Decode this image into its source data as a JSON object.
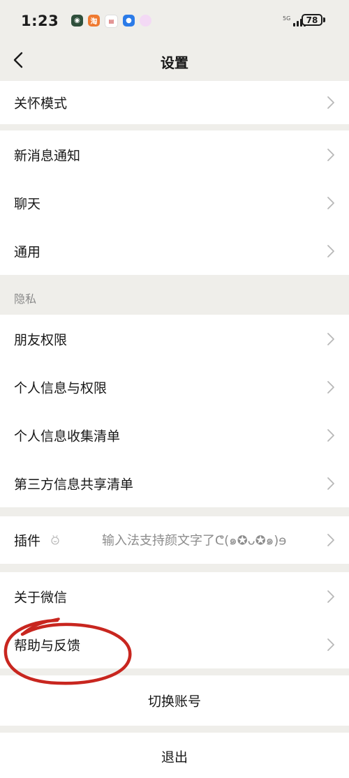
{
  "status_bar": {
    "time": "1:23",
    "battery": "78",
    "network_label": "5G"
  },
  "nav": {
    "title": "设置"
  },
  "section_top": {
    "items": [
      {
        "label": "关怀模式"
      }
    ]
  },
  "section_general": {
    "items": [
      {
        "label": "新消息通知"
      },
      {
        "label": "聊天"
      },
      {
        "label": "通用"
      }
    ]
  },
  "privacy": {
    "group_label": "隐私",
    "items": [
      {
        "label": "朋友权限"
      },
      {
        "label": "个人信息与权限"
      },
      {
        "label": "个人信息收集清单"
      },
      {
        "label": "第三方信息共享清单"
      }
    ]
  },
  "plugins": {
    "label": "插件",
    "value": "输入法支持颜文字了ᕦ(๑✪ᴗ✪๑)ɘ"
  },
  "about": {
    "items": [
      {
        "label": "关于微信"
      },
      {
        "label": "帮助与反馈"
      }
    ]
  },
  "account": {
    "switch_label": "切换账号",
    "logout_label": "退出"
  },
  "colors": {
    "background": "#efeeea",
    "card": "#ffffff",
    "annotation": "#c8261f"
  }
}
